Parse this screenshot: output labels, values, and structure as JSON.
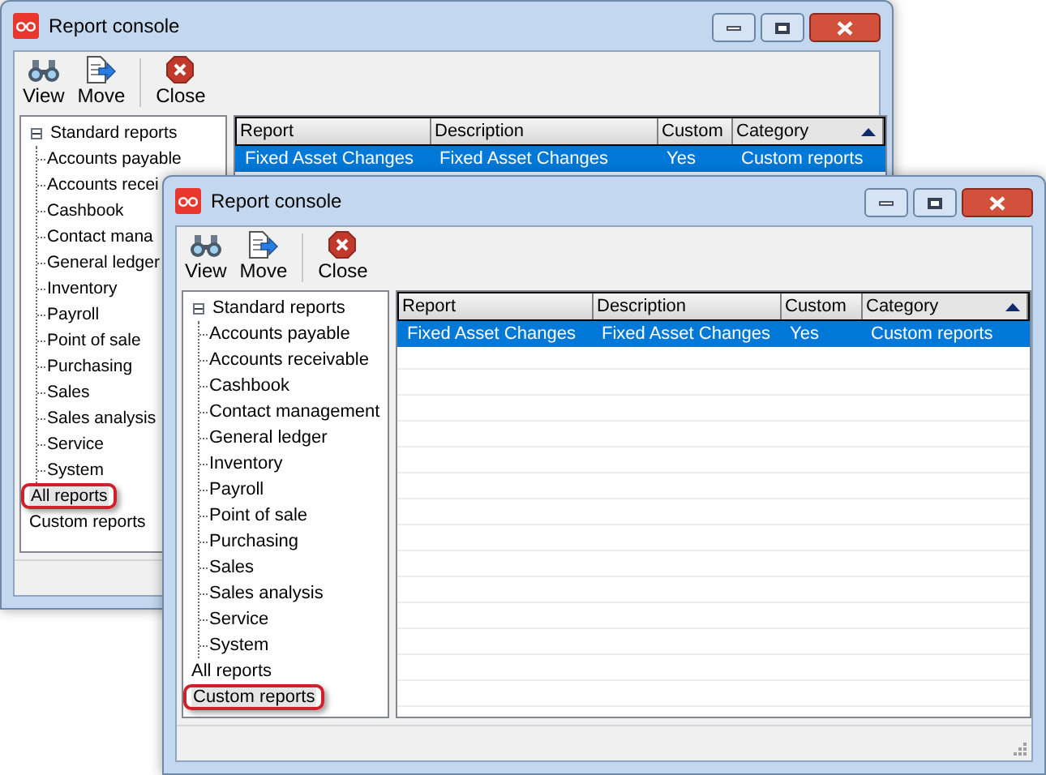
{
  "windows": [
    {
      "title": "Report console",
      "toolbar": [
        {
          "label": "View",
          "kind": "view"
        },
        {
          "label": "Move",
          "kind": "move"
        },
        {
          "label": "Close",
          "kind": "close"
        }
      ],
      "tree": [
        {
          "label": "Standard reports",
          "expanded": true,
          "selected": false,
          "children": [
            {
              "label": "Accounts payable",
              "selected": false
            },
            {
              "label": "Accounts recei",
              "selected": false
            },
            {
              "label": "Cashbook",
              "selected": false
            },
            {
              "label": "Contact mana",
              "selected": false
            },
            {
              "label": "General ledger",
              "selected": false
            },
            {
              "label": "Inventory",
              "selected": false
            },
            {
              "label": "Payroll",
              "selected": false
            },
            {
              "label": "Point of sale",
              "selected": false
            },
            {
              "label": "Purchasing",
              "selected": false
            },
            {
              "label": "Sales",
              "selected": false
            },
            {
              "label": "Sales analysis",
              "selected": false
            },
            {
              "label": "Service",
              "selected": false
            },
            {
              "label": "System",
              "selected": false
            }
          ]
        },
        {
          "label": "All reports",
          "selected": true
        },
        {
          "label": "Custom reports",
          "selected": false
        }
      ],
      "table": {
        "columns": [
          {
            "label": "Report",
            "sorted": false
          },
          {
            "label": "Description",
            "sorted": false
          },
          {
            "label": "Custom",
            "sorted": false
          },
          {
            "label": "Category",
            "sorted": true
          }
        ],
        "rows": [
          {
            "cells": [
              "Fixed Asset Changes",
              "Fixed Asset Changes",
              "Yes",
              "Custom reports"
            ],
            "selected": true
          }
        ]
      }
    },
    {
      "title": "Report console",
      "toolbar": [
        {
          "label": "View",
          "kind": "view"
        },
        {
          "label": "Move",
          "kind": "move"
        },
        {
          "label": "Close",
          "kind": "close"
        }
      ],
      "tree": [
        {
          "label": "Standard reports",
          "expanded": true,
          "selected": false,
          "children": [
            {
              "label": "Accounts payable",
              "selected": false
            },
            {
              "label": "Accounts receivable",
              "selected": false
            },
            {
              "label": "Cashbook",
              "selected": false
            },
            {
              "label": "Contact management",
              "selected": false
            },
            {
              "label": "General ledger",
              "selected": false
            },
            {
              "label": "Inventory",
              "selected": false
            },
            {
              "label": "Payroll",
              "selected": false
            },
            {
              "label": "Point of sale",
              "selected": false
            },
            {
              "label": "Purchasing",
              "selected": false
            },
            {
              "label": "Sales",
              "selected": false
            },
            {
              "label": "Sales analysis",
              "selected": false
            },
            {
              "label": "Service",
              "selected": false
            },
            {
              "label": "System",
              "selected": false
            }
          ]
        },
        {
          "label": "All reports",
          "selected": false
        },
        {
          "label": "Custom reports",
          "selected": true
        }
      ],
      "table": {
        "columns": [
          {
            "label": "Report",
            "sorted": false
          },
          {
            "label": "Description",
            "sorted": false
          },
          {
            "label": "Custom",
            "sorted": false
          },
          {
            "label": "Category",
            "sorted": true
          }
        ],
        "rows": [
          {
            "cells": [
              "Fixed Asset Changes",
              "Fixed Asset Changes",
              "Yes",
              "Custom reports"
            ],
            "selected": true
          }
        ]
      }
    }
  ]
}
